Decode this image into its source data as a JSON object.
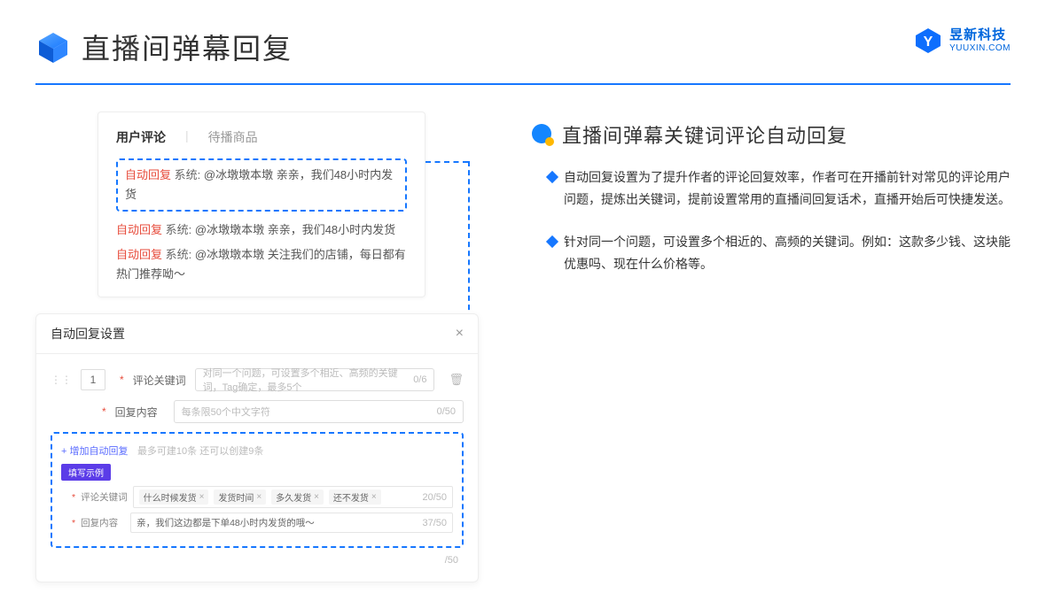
{
  "header": {
    "title": "直播间弹幕回复",
    "logo_cn": "昱新科技",
    "logo_en": "YUUXIN.COM"
  },
  "panel_comments": {
    "tab_active": "用户评论",
    "tab_inactive": "待播商品",
    "highlighted": {
      "tag": "自动回复",
      "sys": "系统:",
      "text": "@冰墩墩本墩 亲亲，我们48小时内发货"
    },
    "rows": [
      {
        "tag": "自动回复",
        "sys": "系统:",
        "text": "@冰墩墩本墩 亲亲，我们48小时内发货"
      },
      {
        "tag": "自动回复",
        "sys": "系统:",
        "text": "@冰墩墩本墩 关注我们的店铺，每日都有热门推荐呦～"
      }
    ]
  },
  "panel_settings": {
    "title": "自动回复设置",
    "num": "1",
    "row1_label": "评论关键词",
    "row1_placeholder": "对同一个问题，可设置多个相近、高频的关键词，Tag确定，最多5个",
    "row1_count": "0/6",
    "row2_label": "回复内容",
    "row2_placeholder": "每条限50个中文字符",
    "row2_count": "0/50",
    "add_link": "+ 增加自动回复",
    "add_note": "最多可建10条 还可以创建9条",
    "badge": "填写示例",
    "ex1_label": "评论关键词",
    "ex1_tags": [
      "什么时候发货",
      "发货时间",
      "多久发货",
      "还不发货"
    ],
    "ex1_count": "20/50",
    "ex2_label": "回复内容",
    "ex2_text": "亲，我们这边都是下单48小时内发货的哦～",
    "ex2_count": "37/50",
    "tail_count": "/50"
  },
  "right": {
    "title": "直播间弹幕关键词评论自动回复",
    "points": [
      "自动回复设置为了提升作者的评论回复效率，作者可在开播前针对常见的评论用户问题，提炼出关键词，提前设置常用的直播间回复话术，直播开始后可快捷发送。",
      "针对同一个问题，可设置多个相近的、高频的关键词。例如：这款多少钱、这块能优惠吗、现在什么价格等。"
    ]
  }
}
